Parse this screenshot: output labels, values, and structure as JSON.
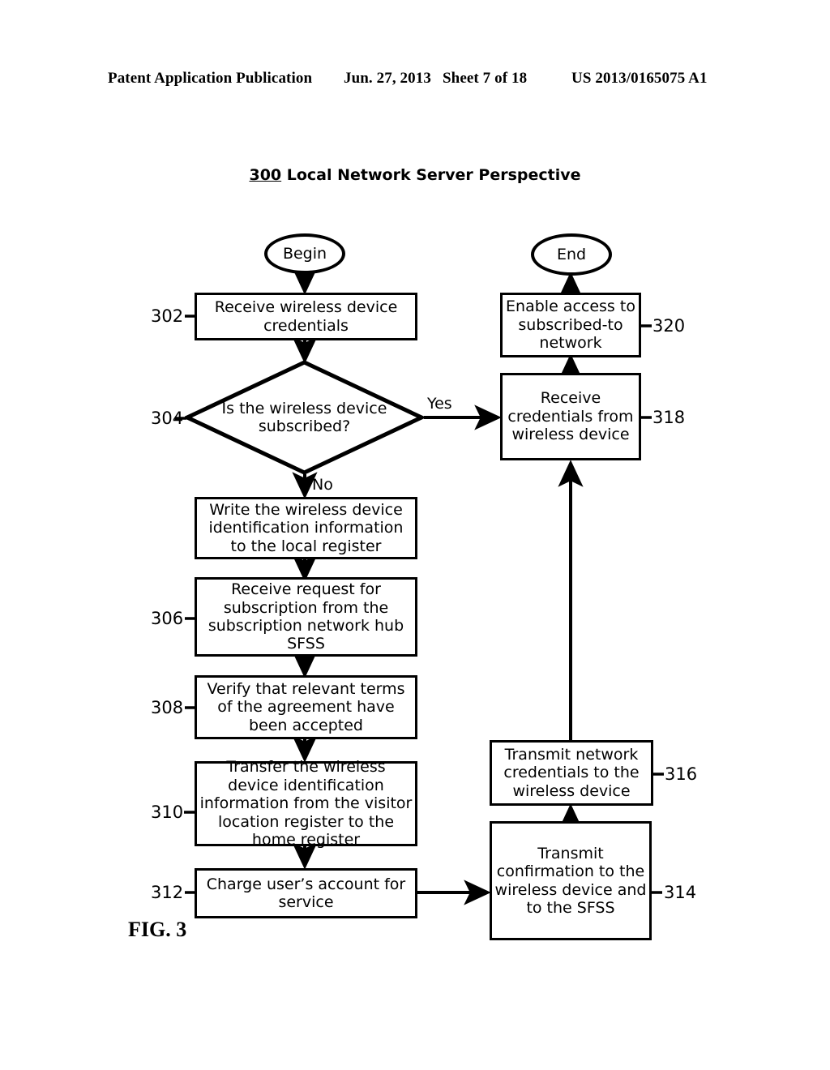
{
  "header": {
    "left": "Patent Application Publication",
    "date": "Jun. 27, 2013",
    "sheet": "Sheet 7 of 18",
    "publication_number": "US 2013/0165075 A1"
  },
  "figure": {
    "number_label": "FIG. 3",
    "title_ref": "300",
    "title_text": " Local Network Server Perspective"
  },
  "nodes": {
    "begin": {
      "label": "Begin"
    },
    "end": {
      "label": "End"
    },
    "n302": {
      "ref": "302",
      "label": "Receive wireless device credentials"
    },
    "n304": {
      "ref": "304",
      "label": "Is the wireless device subscribed?"
    },
    "n_write": {
      "label": "Write the wireless device identification information to the local register"
    },
    "n306": {
      "ref": "306",
      "label": "Receive request for subscription from the subscription network hub SFSS"
    },
    "n308": {
      "ref": "308",
      "label": "Verify that relevant terms of the agreement have been   accepted"
    },
    "n310": {
      "ref": "310",
      "label": "Transfer the wireless device identification information from the visitor location register to the home register"
    },
    "n312": {
      "ref": "312",
      "label": "Charge user’s account for service"
    },
    "n314": {
      "ref": "314",
      "label": "Transmit confirmation to the wireless device and to the SFSS"
    },
    "n316": {
      "ref": "316",
      "label": "Transmit network credentials to the wireless device"
    },
    "n318": {
      "ref": "318",
      "label": "Receive credentials from wireless device"
    },
    "n320": {
      "ref": "320",
      "label": "Enable access to subscribed-to network"
    }
  },
  "edge_labels": {
    "yes": "Yes",
    "no": "No"
  },
  "colors": {
    "ink": "#000000",
    "paper": "#ffffff"
  }
}
